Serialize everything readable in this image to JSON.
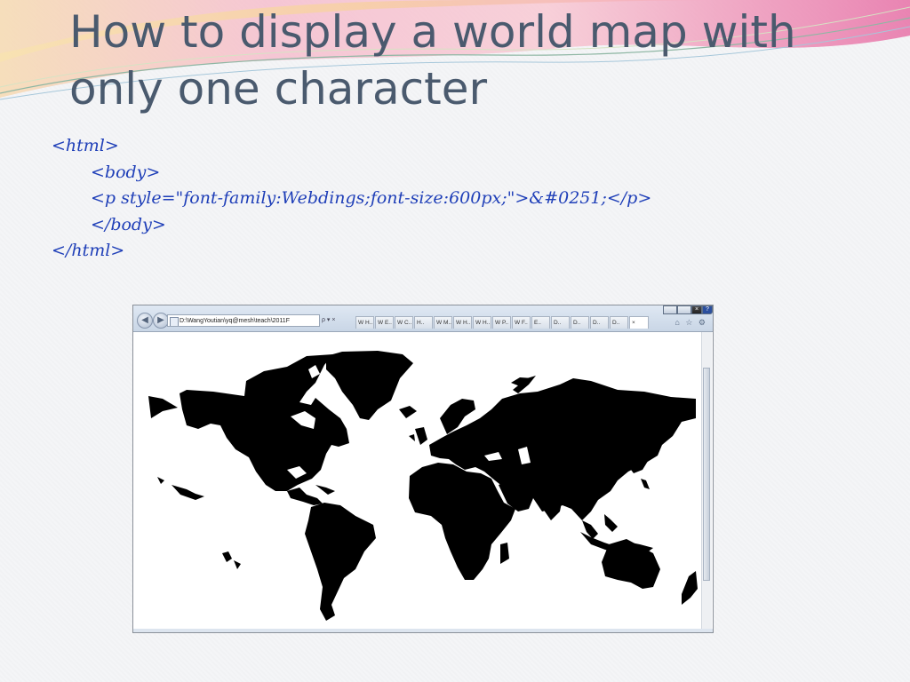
{
  "slide": {
    "title_line1": "How to display a world map with",
    "title_line2": "only one character"
  },
  "code_lines": [
    "<html>",
    "<body>",
    "<p style=\"font-family:Webdings;font-size:600px;\">&#0251;</p>",
    "</body>",
    "</html>"
  ],
  "browser": {
    "address": "D:\\WangYoutian\\yq@mesh\\teach\\2011F",
    "search_refresh": "ρ ▾ ×",
    "tabs": [
      "W H..",
      "W E..",
      "W C..",
      "H..",
      "W M..",
      "W H..",
      "W H..",
      "W P..",
      "W F..",
      "E..",
      "D..",
      "D..",
      "D..",
      "D..",
      "D.."
    ],
    "active_tab": "×",
    "toolbar_icons": "⌂ ☆ ⚙"
  },
  "colors": {
    "title": "#4a5a6e",
    "code": "#1f3fb8",
    "map": "#000000"
  }
}
